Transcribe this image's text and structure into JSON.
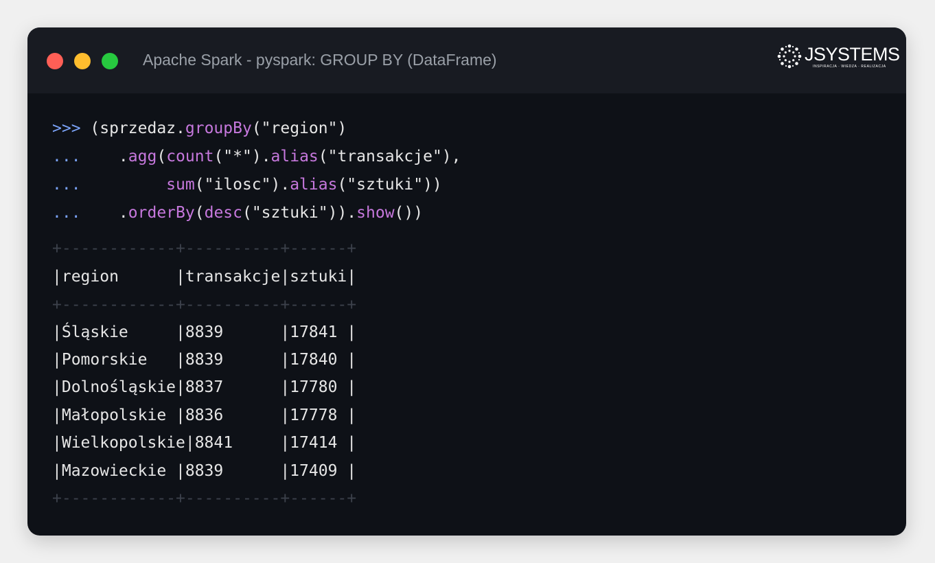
{
  "window": {
    "title": "Apache Spark - pyspark: GROUP BY (DataFrame)"
  },
  "logo": {
    "brand": "JSYSTEMS",
    "tagline": "INSPIRACJA · WIEDZA · REALIZACJA"
  },
  "code": {
    "lines": [
      {
        "prompt": ">>>",
        "parts": [
          " (sprzedaz.",
          "groupBy",
          "(\"region\")"
        ]
      },
      {
        "prompt": "...",
        "parts": [
          "    .",
          "agg",
          "(",
          "count",
          "(\"*\").",
          "alias",
          "(\"transakcje\"),"
        ]
      },
      {
        "prompt": "...",
        "parts": [
          "         ",
          "sum",
          "(\"ilosc\").",
          "alias",
          "(\"sztuki\"))"
        ]
      },
      {
        "prompt": "...",
        "parts": [
          "    .",
          "orderBy",
          "(",
          "desc",
          "(\"sztuki\")).",
          "show",
          "())"
        ]
      }
    ]
  },
  "table": {
    "separator": "+------------+----------+------+",
    "header": "|region      |transakcje|sztuki|",
    "rows": [
      "|Śląskie     |8839      |17841 |",
      "|Pomorskie   |8839      |17840 |",
      "|Dolnośląskie|8837      |17780 |",
      "|Małopolskie |8836      |17778 |",
      "|Wielkopolskie|8841     |17414 |",
      "|Mazowieckie |8839      |17409 |"
    ]
  },
  "colors": {
    "prompt": "#7aa2f7",
    "function": "#c678dd",
    "text": "#e6e6e6",
    "separator": "#3c414b",
    "close": "#ff5f56",
    "minimize": "#ffbd2e",
    "maximize": "#27c93f"
  }
}
